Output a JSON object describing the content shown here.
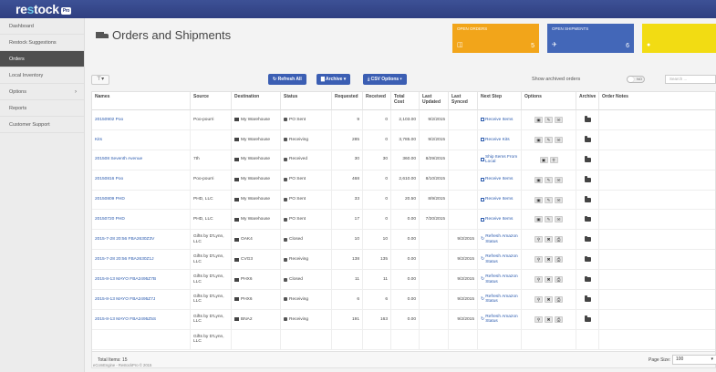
{
  "brand": {
    "name_part1": "re",
    "name_part2": "s",
    "name_part3": "tock",
    "badge": "Pro"
  },
  "sidebar": {
    "items": [
      {
        "label": "Dashboard"
      },
      {
        "label": "Restock Suggestions"
      },
      {
        "label": "Orders"
      },
      {
        "label": "Local Inventory"
      },
      {
        "label": "Options"
      },
      {
        "label": "Reports"
      },
      {
        "label": "Customer Support"
      }
    ]
  },
  "page": {
    "title": "Orders and Shipments"
  },
  "tiles": [
    {
      "title": "Open Orders",
      "icon": "◫",
      "count": "5",
      "color": "#f2a51a"
    },
    {
      "title": "Open Shipments",
      "icon": "✈",
      "count": "6",
      "color": "#4367b8"
    },
    {
      "title": "",
      "icon": "●",
      "count": "",
      "color": "#f2dc13"
    }
  ],
  "toolbar": {
    "refresh_label": "↻ Refresh All",
    "archive_label": "▇ Archive ▾",
    "csv_label": "⤓ CSV Options ▾",
    "show_archived_label": "Show archived orders",
    "toggle_label": "NO",
    "search_placeholder": "Search ..."
  },
  "table": {
    "columns": [
      "Names",
      "Source",
      "Destination",
      "Status",
      "Requested",
      "Received",
      "Total Cost",
      "Last Updated",
      "Last Synced",
      "Next Step",
      "Options",
      "Archive",
      "Order Notes"
    ],
    "rows": [
      {
        "name": "20150902 Poo",
        "source": "Poo-pourri",
        "destination": "My Warehouse",
        "status": "PO Sent",
        "requested": "9",
        "received": "0",
        "cost": "2,103.00",
        "updated": "9/2/2015",
        "synced": "",
        "next": "Receive Items",
        "next_kind": "check",
        "opts": [
          "▣",
          "✎",
          "✉"
        ]
      },
      {
        "name": "Kits",
        "source": "",
        "destination": "My Warehouse",
        "status": "Receiving",
        "requested": "285",
        "received": "0",
        "cost": "3,785.00",
        "updated": "9/2/2015",
        "synced": "",
        "next": "Receive Kits",
        "next_kind": "check",
        "opts": [
          "▣",
          "✎",
          "✉"
        ]
      },
      {
        "name": "201508 Seventh Avenue",
        "source": "7th",
        "destination": "My Warehouse",
        "status": "Received",
        "requested": "30",
        "received": "30",
        "cost": "360.00",
        "updated": "8/29/2015",
        "synced": "",
        "next": "Ship Items From Local",
        "next_kind": "check",
        "opts": [
          "▣",
          "⚲"
        ]
      },
      {
        "name": "20150816 Poo",
        "source": "Poo-pourri",
        "destination": "My Warehouse",
        "status": "PO Sent",
        "requested": "468",
        "received": "0",
        "cost": "2,610.00",
        "updated": "8/10/2015",
        "synced": "",
        "next": "Receive Items",
        "next_kind": "check",
        "opts": [
          "▣",
          "✎",
          "✉"
        ]
      },
      {
        "name": "20150809 PHD",
        "source": "PHD, LLC",
        "destination": "My Warehouse",
        "status": "PO Sent",
        "requested": "33",
        "received": "0",
        "cost": "20.50",
        "updated": "8/9/2015",
        "synced": "",
        "next": "Receive Items",
        "next_kind": "check",
        "opts": [
          "▣",
          "✎",
          "✉"
        ]
      },
      {
        "name": "20150720 PHD",
        "source": "PHD, LLC",
        "destination": "My Warehouse",
        "status": "PO Sent",
        "requested": "17",
        "received": "0",
        "cost": "0.00",
        "updated": "7/20/2015",
        "synced": "",
        "next": "Receive Items",
        "next_kind": "check",
        "opts": [
          "▣",
          "✎",
          "✉"
        ]
      },
      {
        "name": "2015-7-28 20:56 FBA2630Z3V",
        "source": "Gifts by D'Lynn, LLC",
        "destination": "OAK4",
        "status": "Closed",
        "requested": "10",
        "received": "10",
        "cost": "0.00",
        "updated": "",
        "synced": "9/2/2015",
        "next": "Refresh Amazon Status",
        "next_kind": "refresh",
        "opts": [
          "⚲",
          "✖",
          "⎙"
        ]
      },
      {
        "name": "2015-7-28 20:56 FBA2630Z1J",
        "source": "Gifts by D'Lynn, LLC",
        "destination": "CVG3",
        "status": "Receiving",
        "requested": "138",
        "received": "135",
        "cost": "0.00",
        "updated": "",
        "synced": "9/2/2015",
        "next": "Refresh Amazon Status",
        "next_kind": "refresh",
        "opts": [
          "⚲",
          "✖",
          "⎙"
        ]
      },
      {
        "name": "2015-8-13 MAYO FBA2495Z7B",
        "source": "Gifts by D'Lynn, LLC",
        "destination": "PHX6",
        "status": "Closed",
        "requested": "11",
        "received": "11",
        "cost": "0.00",
        "updated": "",
        "synced": "9/2/2015",
        "next": "Refresh Amazon Status",
        "next_kind": "refresh",
        "opts": [
          "⚲",
          "✖",
          "⎙"
        ]
      },
      {
        "name": "2015-8-13 MAYO FBA2495Z7J",
        "source": "Gifts by D'Lynn, LLC",
        "destination": "PHX6",
        "status": "Receiving",
        "requested": "6",
        "received": "6",
        "cost": "0.00",
        "updated": "",
        "synced": "9/2/2015",
        "next": "Refresh Amazon Status",
        "next_kind": "refresh",
        "opts": [
          "⚲",
          "✖",
          "⎙"
        ]
      },
      {
        "name": "2015-8-13 MAYO FBA2495Z5S",
        "source": "Gifts by D'Lynn, LLC",
        "destination": "BNA2",
        "status": "Receiving",
        "requested": "191",
        "received": "163",
        "cost": "0.00",
        "updated": "",
        "synced": "9/2/2015",
        "next": "Refresh Amazon Status",
        "next_kind": "refresh",
        "opts": [
          "⚲",
          "✖",
          "⎙"
        ]
      },
      {
        "name": "",
        "source": "Gifts by D'Lynn, LLC",
        "destination": "",
        "status": "",
        "requested": "",
        "received": "",
        "cost": "",
        "updated": "",
        "synced": "",
        "next": "",
        "next_kind": "",
        "opts": []
      }
    ]
  },
  "footer": {
    "total_items": "Total Items: 15",
    "page_size_label": "Page Size:",
    "page_size_value": "100"
  },
  "copyright": "eComEngine - RestockPro © 2015"
}
